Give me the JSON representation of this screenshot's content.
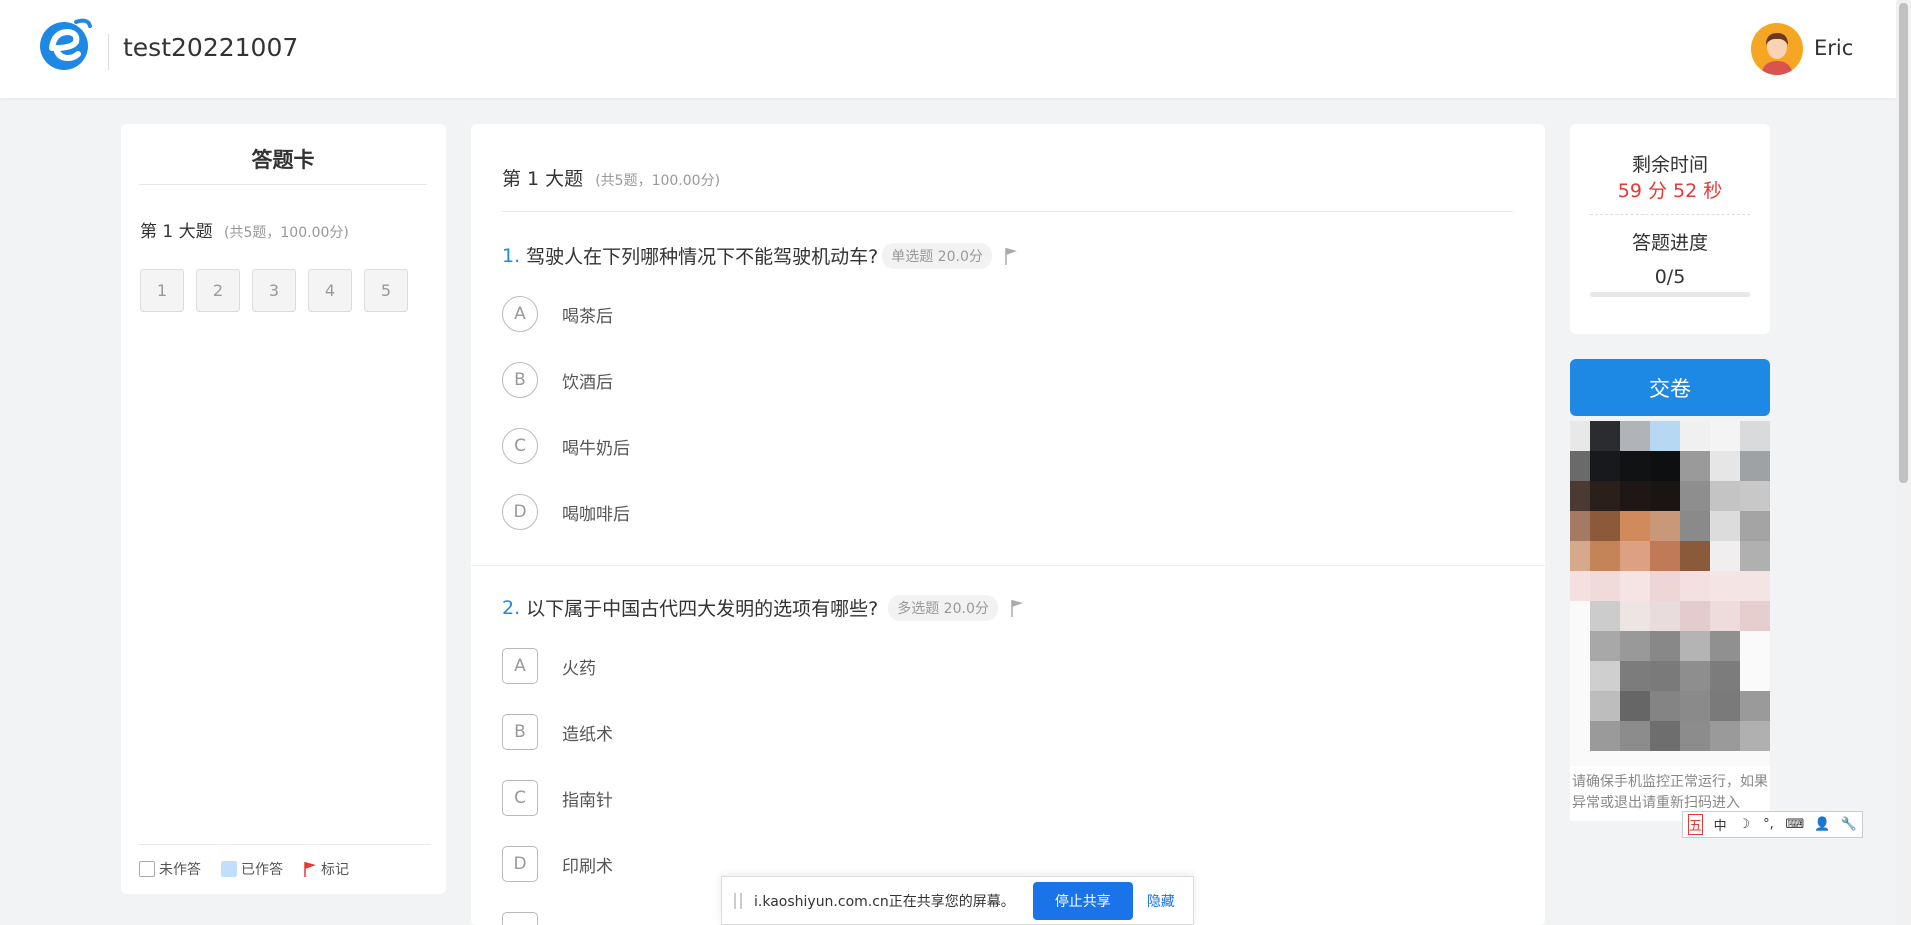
{
  "header": {
    "exam_title": "test20221007",
    "user_name": "Eric"
  },
  "answer_card": {
    "title": "答题卡",
    "section_title": "第 1 大题",
    "section_meta": "(共5题，100.00分)",
    "numbers": [
      "1",
      "2",
      "3",
      "4",
      "5"
    ],
    "legend": {
      "unanswered": "未作答",
      "answered": "已作答",
      "flagged": "标记"
    }
  },
  "main": {
    "section_title": "第 1 大题",
    "section_meta": "(共5题，100.00分)",
    "questions": [
      {
        "number": "1.",
        "text": "驾驶人在下列哪种情况下不能驾驶机动车?",
        "tag": "单选题 20.0分",
        "options": [
          {
            "letter": "A",
            "text": "喝茶后"
          },
          {
            "letter": "B",
            "text": "饮酒后"
          },
          {
            "letter": "C",
            "text": "喝牛奶后"
          },
          {
            "letter": "D",
            "text": "喝咖啡后"
          }
        ]
      },
      {
        "number": "2.",
        "text": "以下属于中国古代四大发明的选项有哪些?",
        "tag": "多选题 20.0分",
        "options": [
          {
            "letter": "A",
            "text": "火药"
          },
          {
            "letter": "B",
            "text": "造纸术"
          },
          {
            "letter": "C",
            "text": "指南针"
          },
          {
            "letter": "D",
            "text": "印刷术"
          }
        ]
      }
    ]
  },
  "status": {
    "time_label": "剩余时间",
    "time_value": "59 分 52 秒",
    "progress_label": "答题进度",
    "progress_value": "0/5",
    "progress_fraction": 0
  },
  "submit_label": "交卷",
  "monitor_note": "请确保手机监控正常运行，如果异常或退出请重新扫码进入",
  "ime": [
    "五",
    "中",
    "☽",
    "°,",
    "⌨",
    "👤",
    "🔧"
  ],
  "share_bar": {
    "text": "i.kaoshiyun.com.cn正在共享您的屏幕。",
    "stop_label": "停止共享",
    "hide_label": "隐藏"
  },
  "colors": {
    "accent": "#1e88e5",
    "timer": "#e53935",
    "answered": "#bfe0fb"
  }
}
